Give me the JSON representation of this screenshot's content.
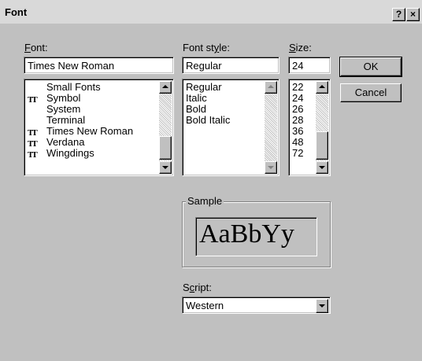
{
  "window": {
    "title": "Font",
    "help_button": "?",
    "close_button": "×"
  },
  "font": {
    "label": "Font:",
    "label_accel": "F",
    "label_rest": "ont:",
    "value": "Times New Roman",
    "items": [
      {
        "label": "Small Fonts",
        "truetype": false
      },
      {
        "label": "Symbol",
        "truetype": true
      },
      {
        "label": "System",
        "truetype": false
      },
      {
        "label": "Terminal",
        "truetype": false
      },
      {
        "label": "Times New Roman",
        "truetype": true
      },
      {
        "label": "Verdana",
        "truetype": true
      },
      {
        "label": "Wingdings",
        "truetype": true
      }
    ]
  },
  "style": {
    "label": "Font style:",
    "label_pre": "Font st",
    "label_accel": "y",
    "label_rest": "le:",
    "value": "Regular",
    "items": [
      "Regular",
      "Italic",
      "Bold",
      "Bold Italic"
    ]
  },
  "size": {
    "label": "Size:",
    "label_accel": "S",
    "label_rest": "ize:",
    "value": "24",
    "items": [
      "22",
      "24",
      "26",
      "28",
      "36",
      "48",
      "72"
    ]
  },
  "buttons": {
    "ok": "OK",
    "cancel": "Cancel"
  },
  "sample": {
    "label": "Sample",
    "text": "AaBbYy"
  },
  "script": {
    "label": "Script:",
    "label_pre": "S",
    "label_accel": "c",
    "label_rest": "ript:",
    "value": "Western"
  },
  "icons": {
    "truetype": "TT"
  }
}
